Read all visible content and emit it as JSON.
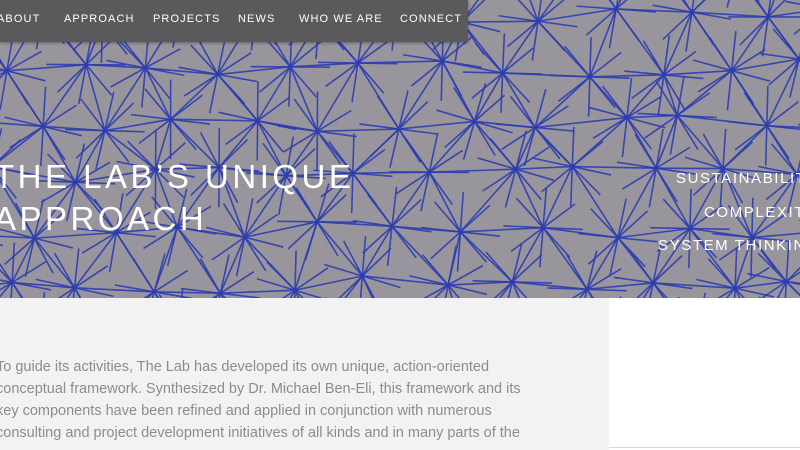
{
  "nav": {
    "items": [
      {
        "label": "ABOUT"
      },
      {
        "label": "APPROACH"
      },
      {
        "label": "PROJECTS"
      },
      {
        "label": "NEWS"
      },
      {
        "label": "WHO WE ARE"
      },
      {
        "label": "CONNECT"
      }
    ]
  },
  "hero": {
    "title_lines": [
      "THE LAB’S UNIQUE",
      "APPROACH"
    ],
    "keywords": [
      "SUSTAINABILITY",
      "COMPLEXITY",
      "SYSTEM THINKING"
    ],
    "background_color": "#98969c",
    "mesh_color": "#2c3cb0"
  },
  "content": {
    "lines": [
      "To guide its activities, The Lab has developed its own unique, action-oriented",
      "conceptual framework. Synthesized by Dr. Michael Ben-Eli, this framework and its",
      "key components have been refined and applied in conjunction with numerous",
      "consulting and project development initiatives of all kinds and in many parts of the"
    ]
  }
}
